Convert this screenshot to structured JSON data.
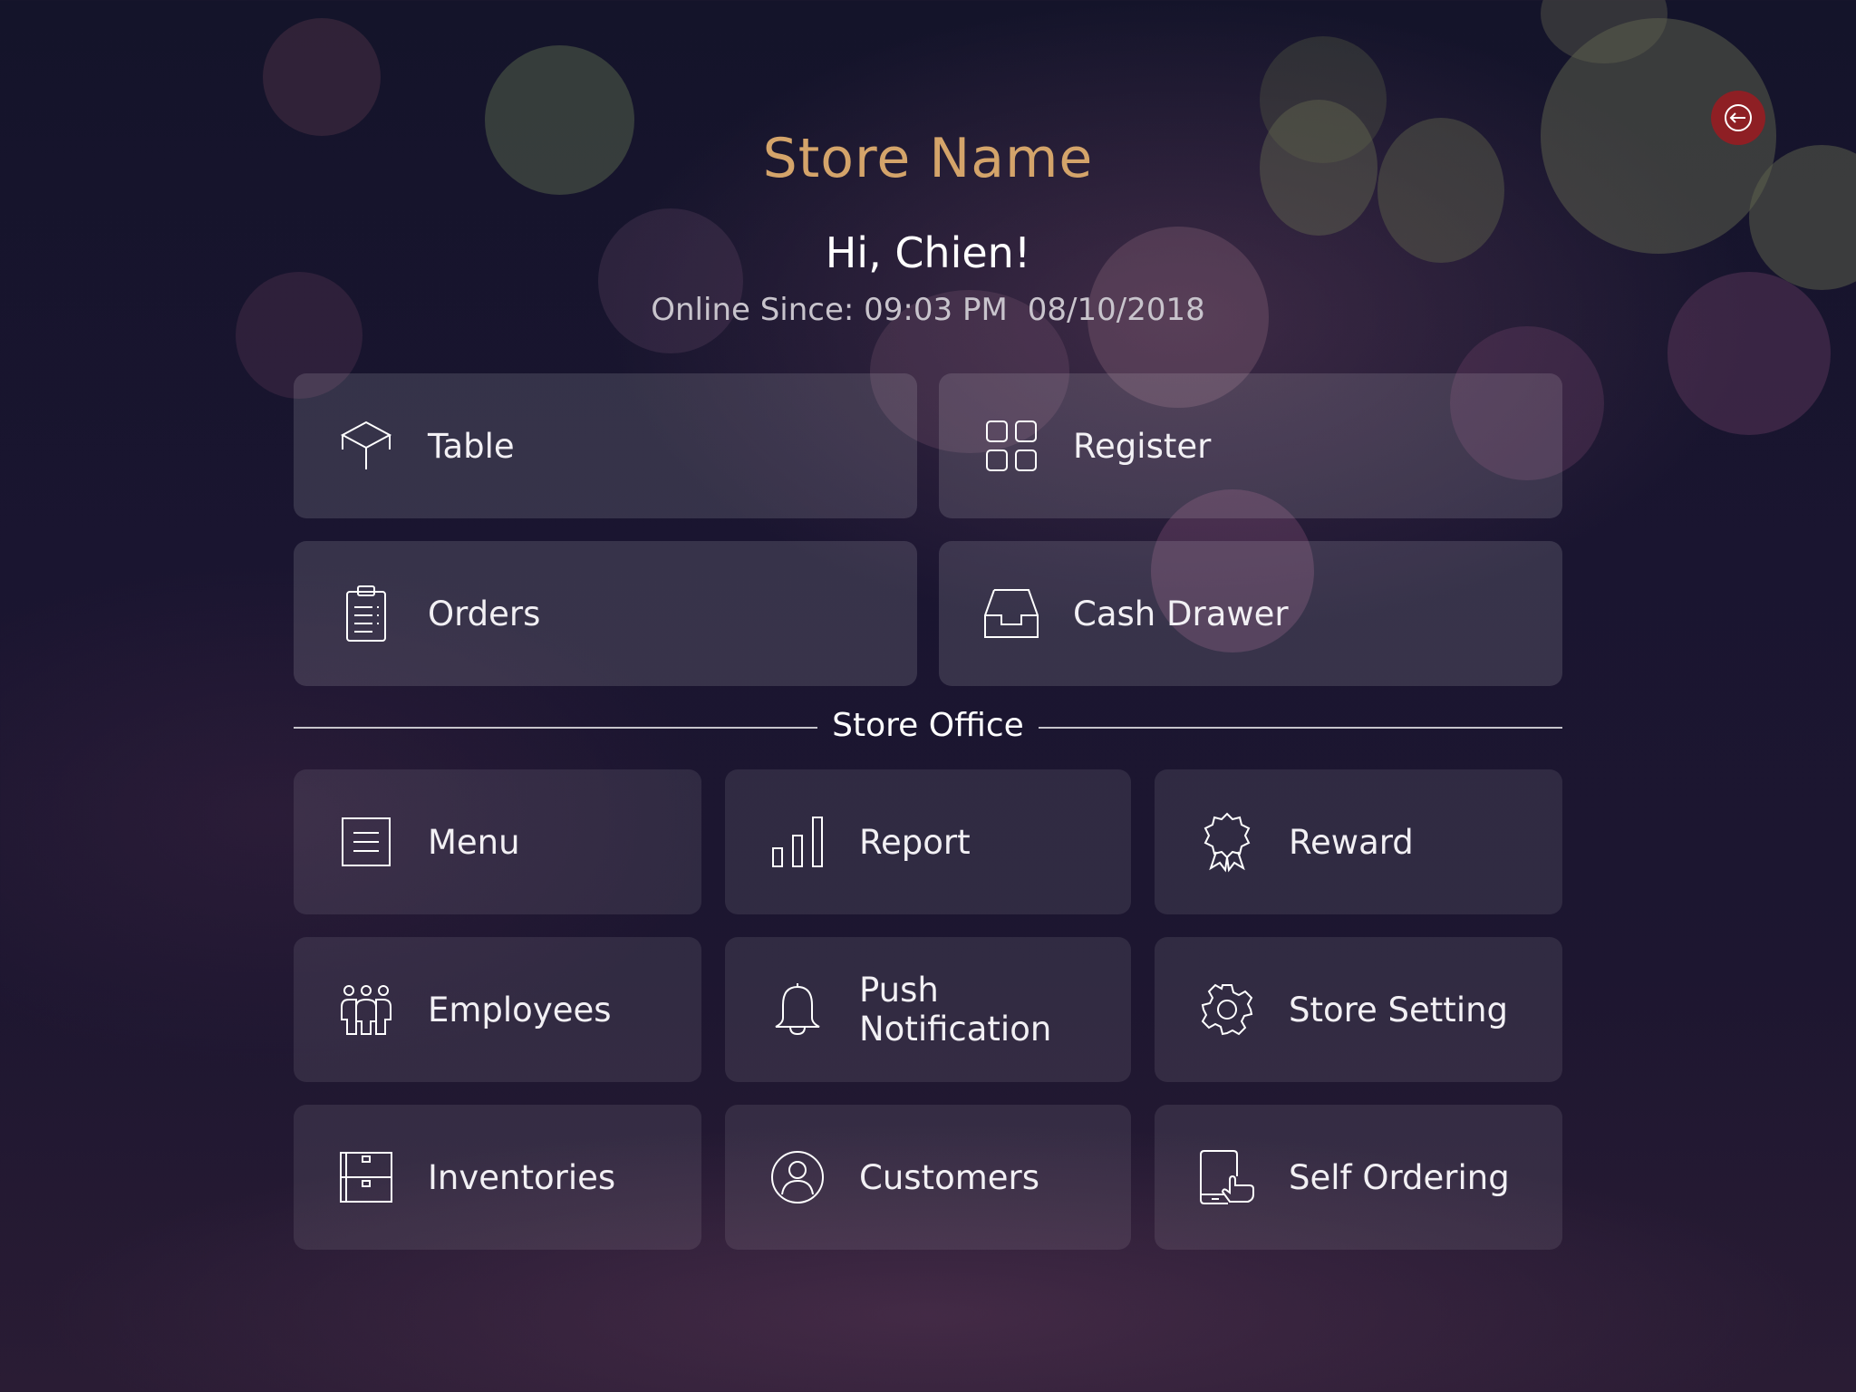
{
  "header": {
    "store_name": "Store Name",
    "greeting": "Hi, Chien!",
    "online_label": "Online Since: 09:03 PM",
    "online_date": "08/10/2018"
  },
  "colors": {
    "store_name": "#d4a46a",
    "logout_button": "#8e1f24"
  },
  "main_tiles": [
    {
      "label": "Table",
      "icon": "table-icon"
    },
    {
      "label": "Register",
      "icon": "register-grid-icon"
    },
    {
      "label": "Orders",
      "icon": "clipboard-icon"
    },
    {
      "label": "Cash Drawer",
      "icon": "drawer-icon"
    }
  ],
  "office": {
    "title": "Store Office",
    "tiles": [
      {
        "label": "Menu",
        "icon": "menu-list-icon"
      },
      {
        "label": "Report",
        "icon": "bar-chart-icon"
      },
      {
        "label": "Reward",
        "icon": "award-ribbon-icon"
      },
      {
        "label": "Employees",
        "icon": "group-icon"
      },
      {
        "label": "Push\nNotification",
        "icon": "bell-icon"
      },
      {
        "label": "Store Setting",
        "icon": "gear-icon"
      },
      {
        "label": "Inventories",
        "icon": "cabinet-icon"
      },
      {
        "label": "Customers",
        "icon": "user-circle-icon"
      },
      {
        "label": "Self Ordering",
        "icon": "tablet-touch-icon"
      }
    ]
  },
  "logout": {
    "icon": "logout-icon"
  }
}
